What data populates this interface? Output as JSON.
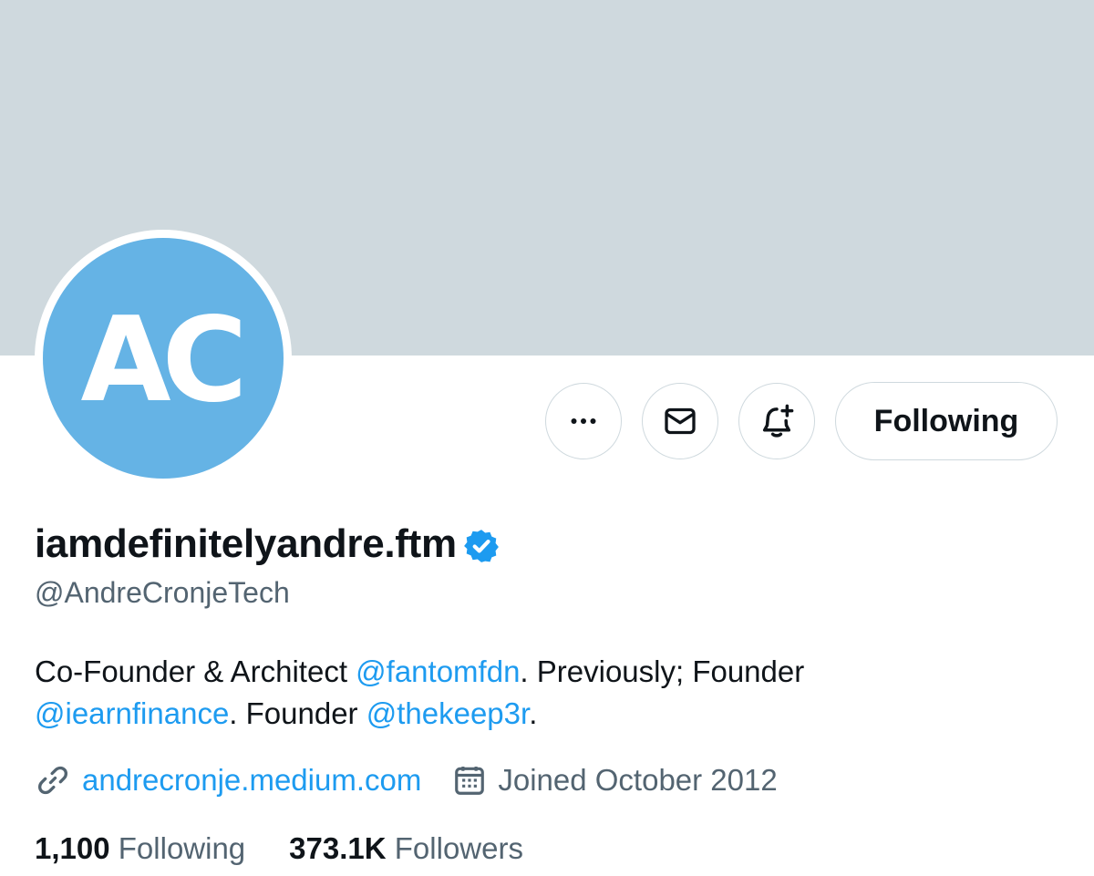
{
  "profile": {
    "avatar_initials": "AC",
    "display_name": "iamdefinitelyandre.ftm",
    "handle": "@AndreCronjeTech",
    "bio": {
      "part1": "Co-Founder & Architect ",
      "mention1": "@fantomfdn",
      "part2": ". Previously; Founder ",
      "mention2": "@iearnfinance",
      "part3": ". Founder ",
      "mention3": "@thekeep3r",
      "part4": "."
    },
    "website": "andrecronje.medium.com",
    "joined": "Joined October 2012",
    "following_count": "1,100",
    "following_label": "Following",
    "followers_count": "373.1K",
    "followers_label": "Followers"
  },
  "actions": {
    "more_icon": "more-horizontal-icon",
    "message_icon": "envelope-icon",
    "notify_icon": "bell-plus-icon",
    "follow_label": "Following"
  },
  "colors": {
    "banner": "#cfd9de",
    "avatar_bg": "#65b3e5",
    "accent": "#1d9bf0",
    "secondary_text": "#536471",
    "verified_badge": "#1d9bf0"
  }
}
